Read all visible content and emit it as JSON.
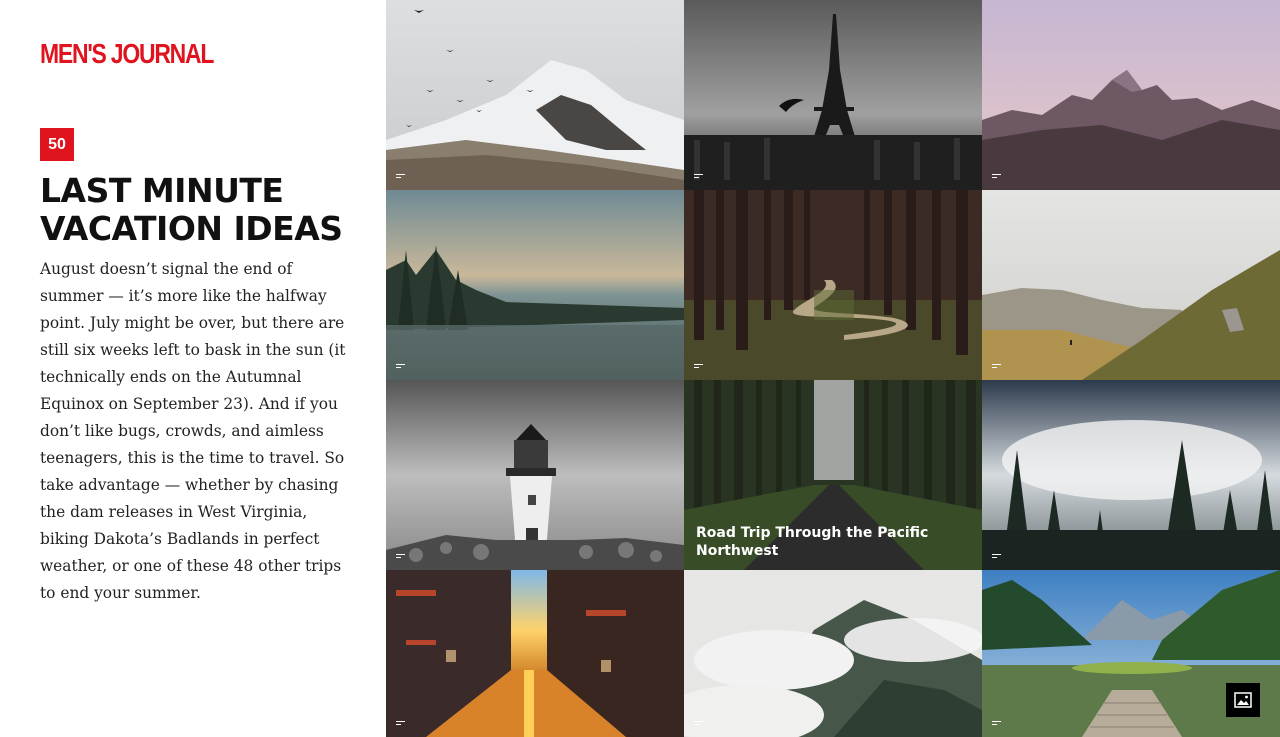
{
  "brand": {
    "logo_text": "MEN'S JOURNAL",
    "accent_color": "#e0141e"
  },
  "gallery": {
    "count": "50",
    "title": "LAST MINUTE VACATION IDEAS",
    "description": "August doesn’t signal the end of summer — it’s more like the halfway point. July might be over, but there are still six weeks left to bask in the sun (it technically ends on the Autumnal Equinox on September 23). And if you don’t like bugs, crowds, and aimless teenagers, this is the time to travel. So take advantage — whether by chasing the dam releases in West Virginia, biking Dakota’s Badlands in perfect weather, or one of these 48 other trips to end your summer."
  },
  "tiles": [
    {
      "scene": "snowy mountain with birds"
    },
    {
      "scene": "eiffel tower black and white"
    },
    {
      "scene": "purple dusk mountain ridge"
    },
    {
      "scene": "misty lake with pine trees"
    },
    {
      "scene": "winding path through forest"
    },
    {
      "scene": "hillside with hiker"
    },
    {
      "scene": "lighthouse black and white"
    },
    {
      "scene": "forest road",
      "caption": "Road Trip Through the Pacific Northwest"
    },
    {
      "scene": "misty pine forest"
    },
    {
      "scene": "sunset city street"
    },
    {
      "scene": "cloudy mountain"
    },
    {
      "scene": "alpine lake with dock"
    }
  ],
  "icons": {
    "caption": "caption-icon",
    "gallery_toggle": "image-icon"
  }
}
